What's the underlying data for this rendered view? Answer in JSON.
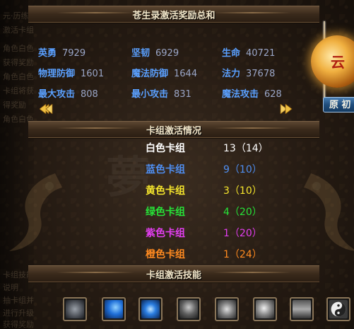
{
  "panel_title": "苍生录激活奖励总和",
  "stats": [
    {
      "label": "英勇",
      "value": "7929"
    },
    {
      "label": "坚韧",
      "value": "6929"
    },
    {
      "label": "生命",
      "value": "40721"
    },
    {
      "label": "物理防御",
      "value": "1601"
    },
    {
      "label": "魔法防御",
      "value": "1644"
    },
    {
      "label": "法力",
      "value": "37678"
    },
    {
      "label": "最大攻击",
      "value": "808"
    },
    {
      "label": "最小攻击",
      "value": "831"
    },
    {
      "label": "魔法攻击",
      "value": "628"
    }
  ],
  "right_button": "原 初",
  "deck_section_title": "卡组激活情况",
  "decks": [
    {
      "name": "白色卡组",
      "value": "13（14）",
      "color": "#ffffff"
    },
    {
      "name": "蓝色卡组",
      "value": "9（10）",
      "color": "#4f8ef0"
    },
    {
      "name": "黄色卡组",
      "value": "3（10）",
      "color": "#f5e52c"
    },
    {
      "name": "绿色卡组",
      "value": "4（20）",
      "color": "#27e338"
    },
    {
      "name": "紫色卡组",
      "value": "1（20）",
      "color": "#e23ef0"
    },
    {
      "name": "橙色卡组",
      "value": "1（24）",
      "color": "#ff8a20"
    }
  ],
  "skills_section_title": "卡组激活技能",
  "skills": [
    {
      "icon": "storm-skill-icon"
    },
    {
      "icon": "crescent-slash-skill-icon"
    },
    {
      "icon": "blue-vortex-skill-icon"
    },
    {
      "icon": "warrior-skill-icon"
    },
    {
      "icon": "whirlwind-skill-icon"
    },
    {
      "icon": "orb-skill-icon"
    },
    {
      "icon": "pillars-skill-icon"
    },
    {
      "icon": "yin-yang-skill-icon"
    }
  ],
  "ghost_text": [
    "元·历练卡",
    "激活卡组",
    "角色白色",
    "获得奖励",
    "角色白色",
    "卡组将获",
    "得奖励",
    "角色白色",
    "卡组技能",
    "说明",
    "抽卡组并",
    "进行升级",
    "获得奖励",
    "激活卡组",
    "说明"
  ]
}
